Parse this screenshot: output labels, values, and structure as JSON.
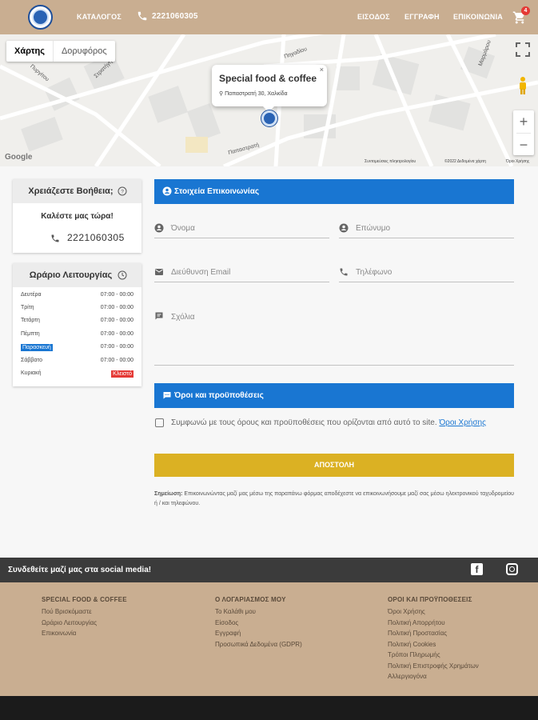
{
  "header": {
    "catalog": "ΚΑΤΑΛΟΓΟΣ",
    "phone": "2221060305",
    "login": "ΕΙΣΟΔΟΣ",
    "register": "ΕΓΓΡΑΦΗ",
    "contact": "ΕΠΙΚΟΙΝΩΝΙΑ",
    "cart_count": "4"
  },
  "map": {
    "tab_map": "Χάρτης",
    "tab_satellite": "Δορυφόρος",
    "info_title": "Special food & coffee",
    "info_address": "Παπαστρατή 30, Χαλκίδα",
    "close": "×",
    "zoom_in": "+",
    "zoom_out": "−",
    "google": "Google",
    "shortcuts": "Συντομεύσεις πληκτρολογίου",
    "mapdata": "©2022 Δεδομένα χάρτη",
    "terms": "Όροι Χρήσης",
    "streets": [
      "Παπαστρατή",
      "Στρατήγη",
      "Πηγαδίου",
      "Πυργίτου",
      "Μαρμάρου"
    ]
  },
  "help": {
    "title": "Χρειάζεστε Βοήθεια;",
    "subtitle": "Καλέστε μας τώρα!",
    "phone": "2221060305"
  },
  "hours": {
    "title": "Ωράριο Λειτουργίας",
    "rows": [
      {
        "day": "Δευτέρα",
        "hours": "07:00 - 00:00"
      },
      {
        "day": "Τρίτη",
        "hours": "07:00 - 00:00"
      },
      {
        "day": "Τετάρτη",
        "hours": "07:00 - 00:00"
      },
      {
        "day": "Πέμπτη",
        "hours": "07:00 - 00:00"
      },
      {
        "day": "Παρασκευή",
        "hours": "07:00 - 00:00"
      },
      {
        "day": "Σάββατο",
        "hours": "07:00 - 00:00"
      },
      {
        "day": "Κυριακή",
        "hours": "Κλειστό"
      }
    ]
  },
  "form": {
    "contact_title": "Στοιχεία Επικοινωνίας",
    "name": "Όνομα",
    "surname": "Επώνυμο",
    "email": "Διεύθυνση Email",
    "phone": "Τηλέφωνο",
    "comments": "Σχόλια",
    "terms_title": "Όροι και προϋποθέσεις",
    "agree_text": "Συμφωνώ με τους όρους και προϋποθέσεις που ορίζονται από αυτό το site.",
    "agree_link": "Όροι Χρήσης",
    "submit": "ΑΠΟΣΤΟΛΗ",
    "note_label": "Σημείωση:",
    "note_text": "Επικοινωνώντας μαζί μας μέσω της παραπάνω φόρμας αποδέχεστε να επικοινωνήσουμε μαζί σας μέσω ηλεκτρονικού ταχυδρομείου ή / και τηλεφώνου."
  },
  "social": {
    "label": "Συνδεθείτε μαζί μας στα social media!",
    "fb": "f"
  },
  "footer": {
    "col1": {
      "title": "SPECIAL FOOD & COFFEE",
      "links": [
        "Πού Βρισκόμαστε",
        "Ωράριο Λειτουργίας",
        "Επικοινωνία"
      ]
    },
    "col2": {
      "title": "Ο ΛΟΓΑΡΙΑΣΜΟΣ ΜΟΥ",
      "links": [
        "Το Καλάθι μου",
        "Είσοδος",
        "Εγγραφή",
        "Προσωπικά Δεδομένα (GDPR)"
      ]
    },
    "col3": {
      "title": "ΟΡΟΙ ΚΑΙ ΠΡΟΫΠΟΘΕΣΕΙΣ",
      "links": [
        "Όροι Χρήσης",
        "Πολιτική Απορρήτου",
        "Πολιτική Προστασίας",
        "Πολιτική Cookies",
        "Τρόποι Πληρωμής",
        "Πολιτική Επιστροφής Χρημάτων",
        "Αλλεργιογόνα"
      ]
    }
  },
  "colors": {
    "accent": "#1976d2",
    "header": "#c9ae91",
    "submit": "#dbb123",
    "closed": "#e53935"
  }
}
